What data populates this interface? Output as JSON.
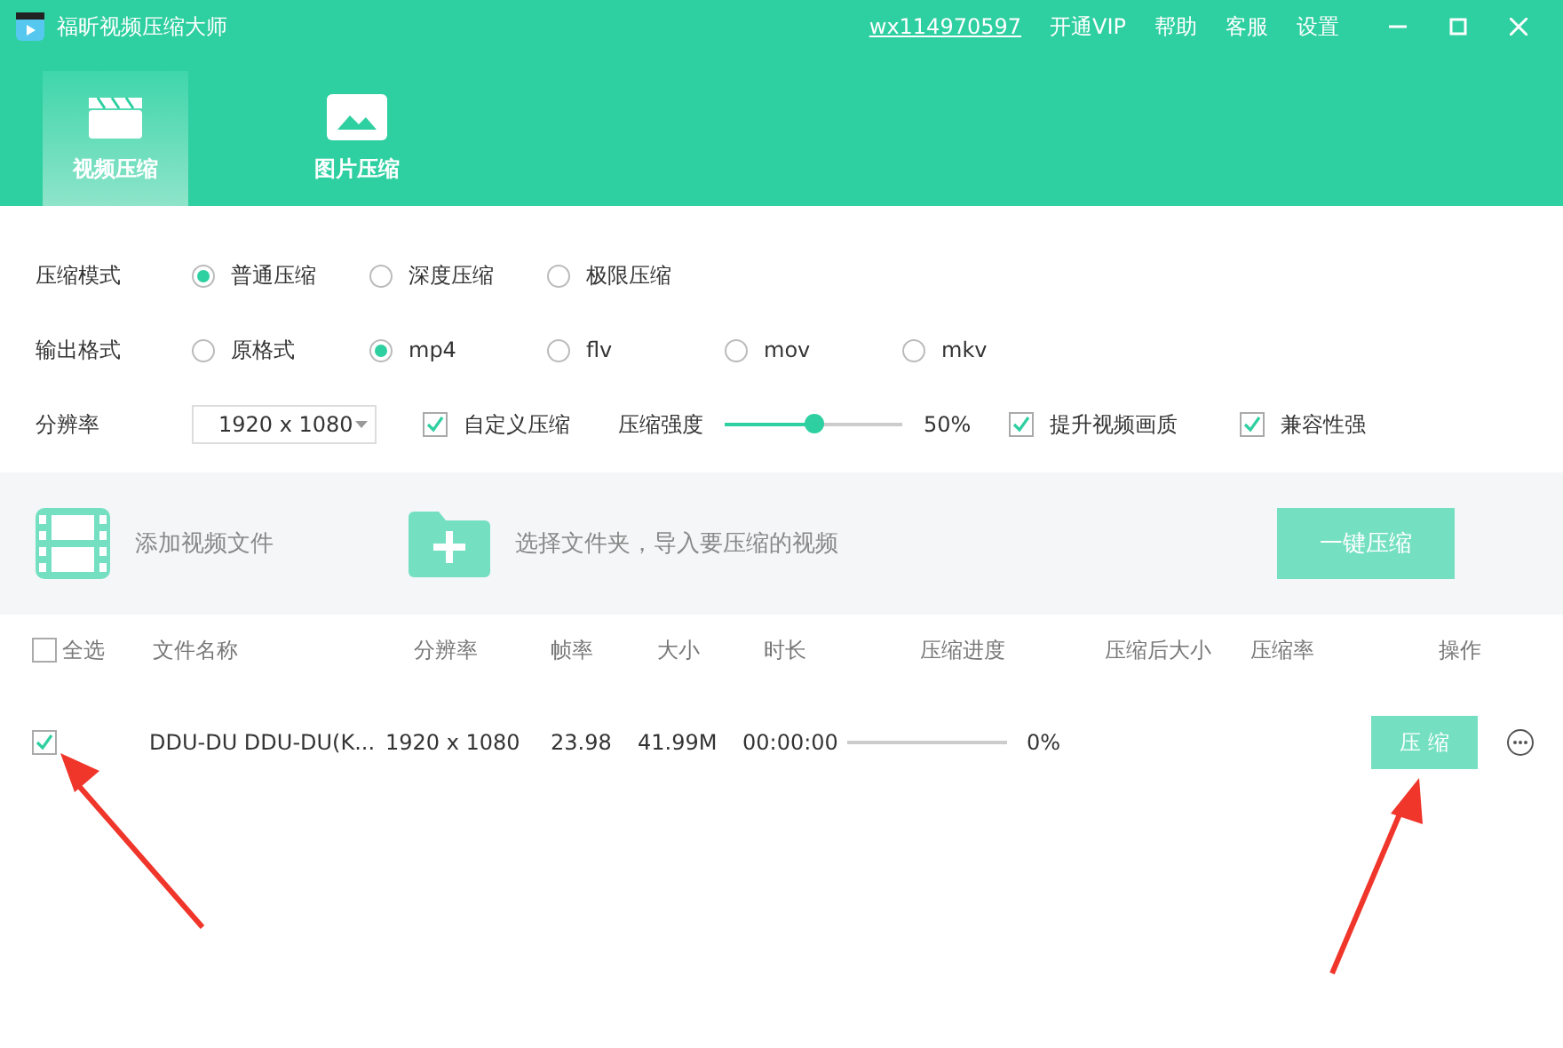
{
  "app": {
    "title": "福昕视频压缩大师"
  },
  "header_links": [
    {
      "label": "wx114970597",
      "kind": "account"
    },
    {
      "label": "开通VIP",
      "kind": "link"
    },
    {
      "label": "帮助",
      "kind": "link"
    },
    {
      "label": "客服",
      "kind": "link"
    },
    {
      "label": "设置",
      "kind": "link"
    }
  ],
  "tabs": [
    {
      "label": "视频压缩",
      "kind": "video",
      "selected": true
    },
    {
      "label": "图片压缩",
      "kind": "image",
      "selected": false
    }
  ],
  "settings": {
    "mode": {
      "label": "压缩模式",
      "options": [
        {
          "label": "普通压缩",
          "selected": true
        },
        {
          "label": "深度压缩",
          "selected": false
        },
        {
          "label": "极限压缩",
          "selected": false
        }
      ]
    },
    "format": {
      "label": "输出格式",
      "options": [
        {
          "label": "原格式",
          "selected": false
        },
        {
          "label": "mp4",
          "selected": true
        },
        {
          "label": "flv",
          "selected": false
        },
        {
          "label": "mov",
          "selected": false
        },
        {
          "label": "mkv",
          "selected": false
        }
      ]
    },
    "resolution": {
      "label": "分辨率",
      "value": "1920 x 1080"
    },
    "custom": {
      "label": "自定义压缩",
      "checked": true
    },
    "strength": {
      "label": "压缩强度",
      "level": 0.5,
      "reading": "50%"
    },
    "enhance": {
      "label": "提升视频画质",
      "checked": true
    },
    "compat": {
      "label": "兼容性强",
      "checked": true
    }
  },
  "actions": {
    "add_file": "添加视频文件",
    "add_folder": "选择文件夹，导入要压缩的视频",
    "compress_all": "一键压缩"
  },
  "table": {
    "select_all": {
      "label": "全选",
      "checked": false
    },
    "columns": [
      "文件名称",
      "分辨率",
      "帧率",
      "大小",
      "时长",
      "压缩进度",
      "压缩后大小",
      "压缩率",
      "操作"
    ],
    "rows": [
      {
        "checked": true,
        "name": "DDU-DU DDU-DU(K...",
        "resolution": "1920 x 1080",
        "fps": "23.98",
        "size": "41.99M",
        "duration": "00:00:00",
        "progress": "0%",
        "button": "压 缩"
      }
    ]
  }
}
